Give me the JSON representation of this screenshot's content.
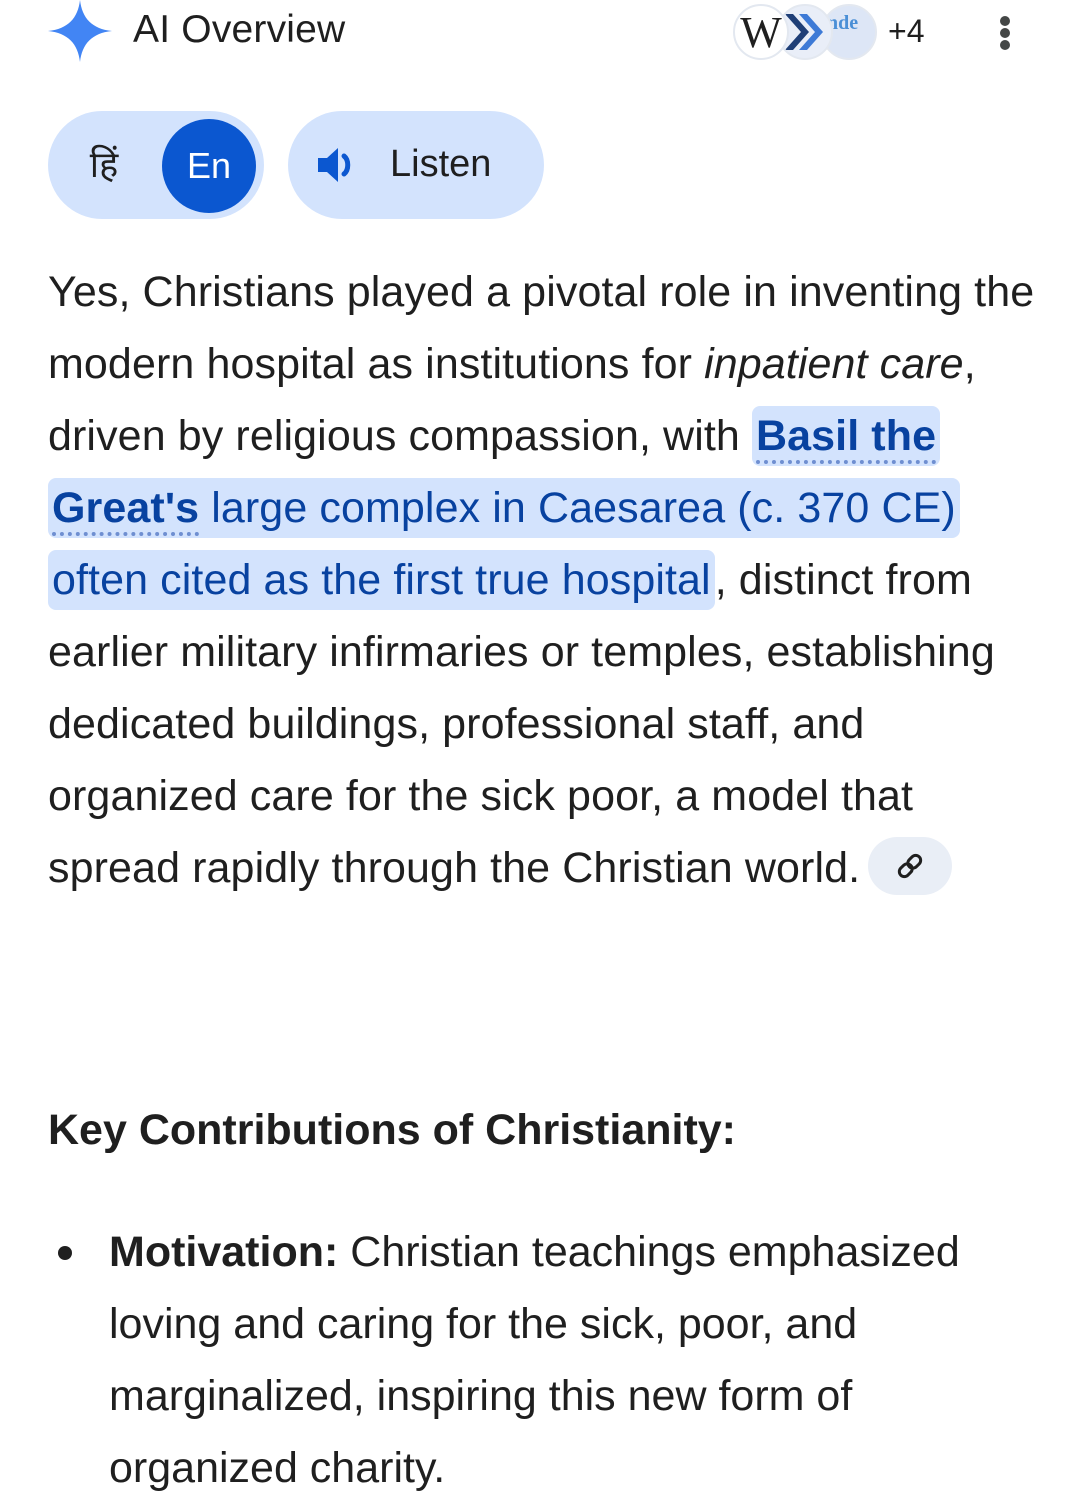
{
  "header": {
    "title": "AI Overview",
    "sources": [
      {
        "name": "wikipedia-icon",
        "label": "W"
      },
      {
        "name": "chevron-source-icon",
        "label": ""
      },
      {
        "name": "nde-source-icon",
        "label": "nde"
      }
    ],
    "more_sources": "+4",
    "menu_icon": "more-vert-icon",
    "accent": "#4285f4"
  },
  "controls": {
    "lang_hindi": "हिं",
    "lang_english": "En",
    "listen_label": "Listen",
    "speaker_icon": "volume-icon",
    "chip_bg": "#d3e3fd",
    "active_bg": "#0b57d0"
  },
  "body": {
    "p1_before": "Yes, Christians played a pivotal role in inventing the modern hospital as institutions for ",
    "p1_italic": "inpatient care",
    "p1_mid": ", driven by religious compassion, with ",
    "p1_hl_bold": "Basil the Great's",
    "p1_hl_rest": " large complex in Caesarea (c. 370 CE) often cited as the first true hospital",
    "p1_after": ", distinct from earlier military infirmaries or temples, establishing dedicated buildings, professional staff, and organized care for the sick poor, a model that spread rapidly through the Christian world.",
    "link_icon": "link-icon",
    "highlight_color": "#d3e3fd",
    "link_text_color": "#0842a0"
  },
  "section": {
    "title": "Key Contributions of Christianity:"
  },
  "list": [
    {
      "term": "Motivation:",
      "text": " Christian teachings emphasized loving and caring for the sick, poor, and marginalized, inspiring this new form of organized charity."
    }
  ]
}
